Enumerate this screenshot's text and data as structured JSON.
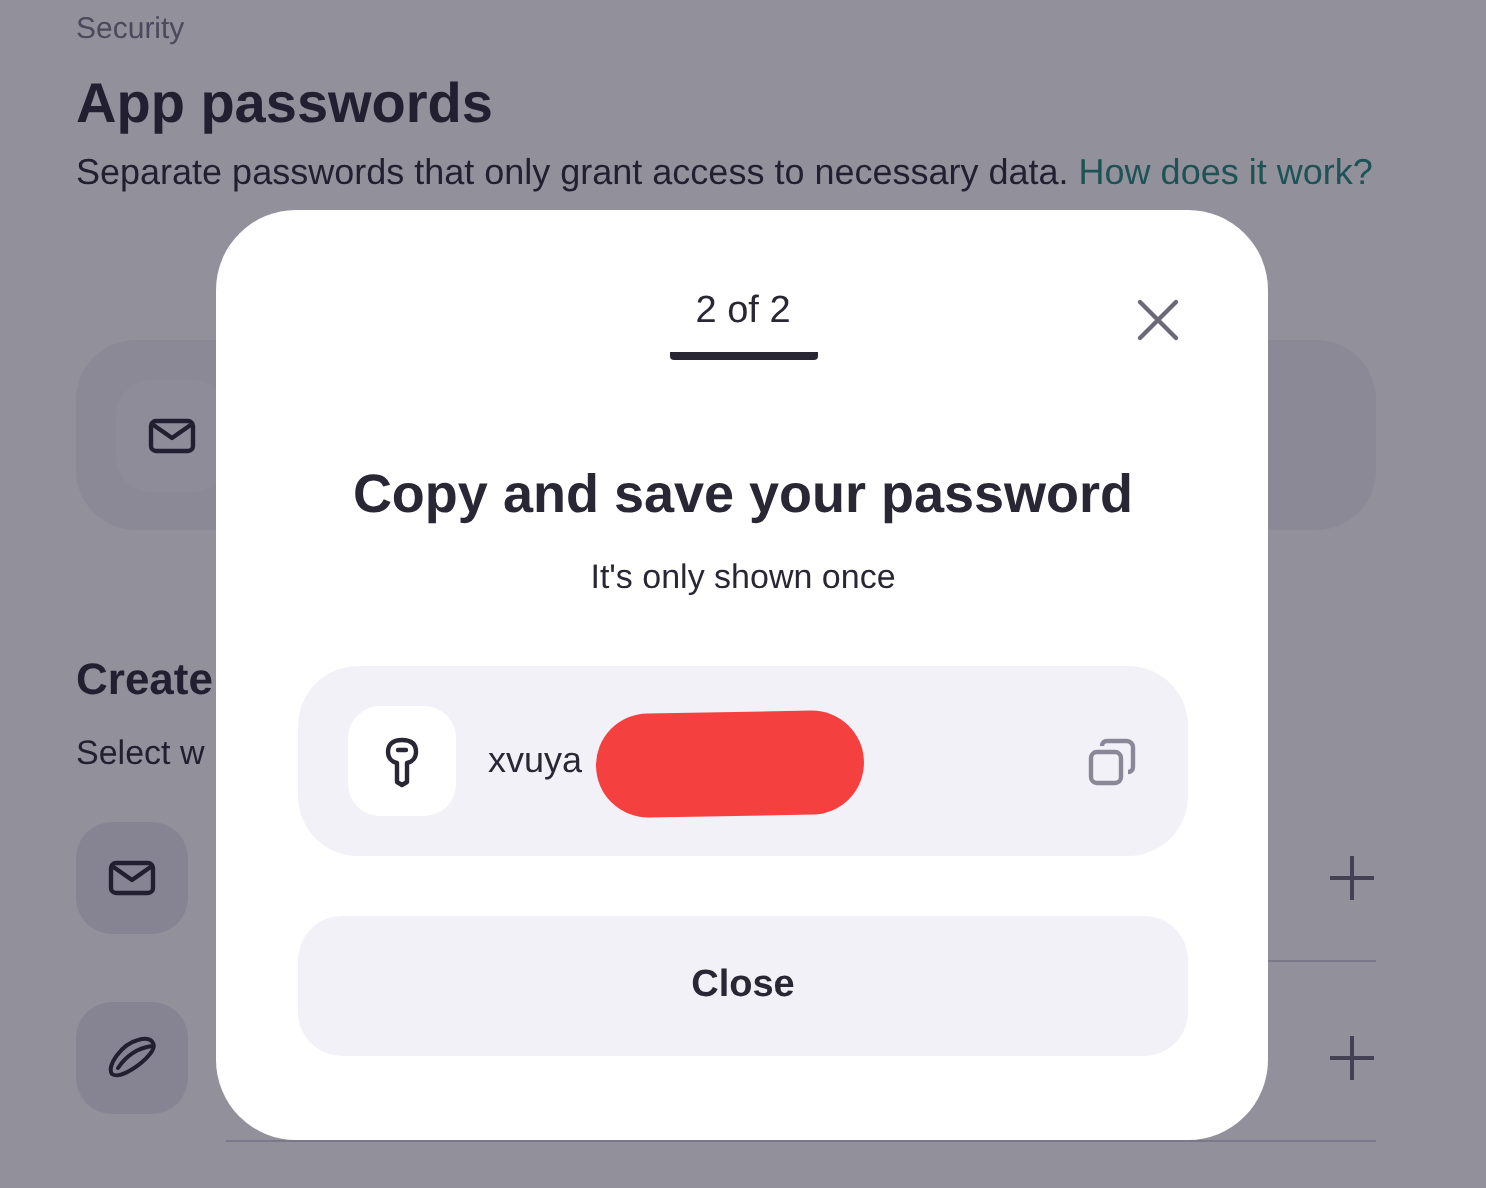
{
  "page": {
    "breadcrumb": "Security",
    "title": "App passwords",
    "description": "Separate passwords that only grant access to necessary data.",
    "help_link": "How does it work?",
    "section_title": "Create",
    "section_subtitle": "Select w"
  },
  "existing_passwords": [
    {
      "kind": "mail"
    }
  ],
  "services": [
    {
      "kind": "mail"
    },
    {
      "kind": "disk"
    }
  ],
  "dialog": {
    "step": "2 of 2",
    "title": "Copy and save your password",
    "subtitle": "It's only shown once",
    "password": "xvuya",
    "close_button": "Close"
  }
}
